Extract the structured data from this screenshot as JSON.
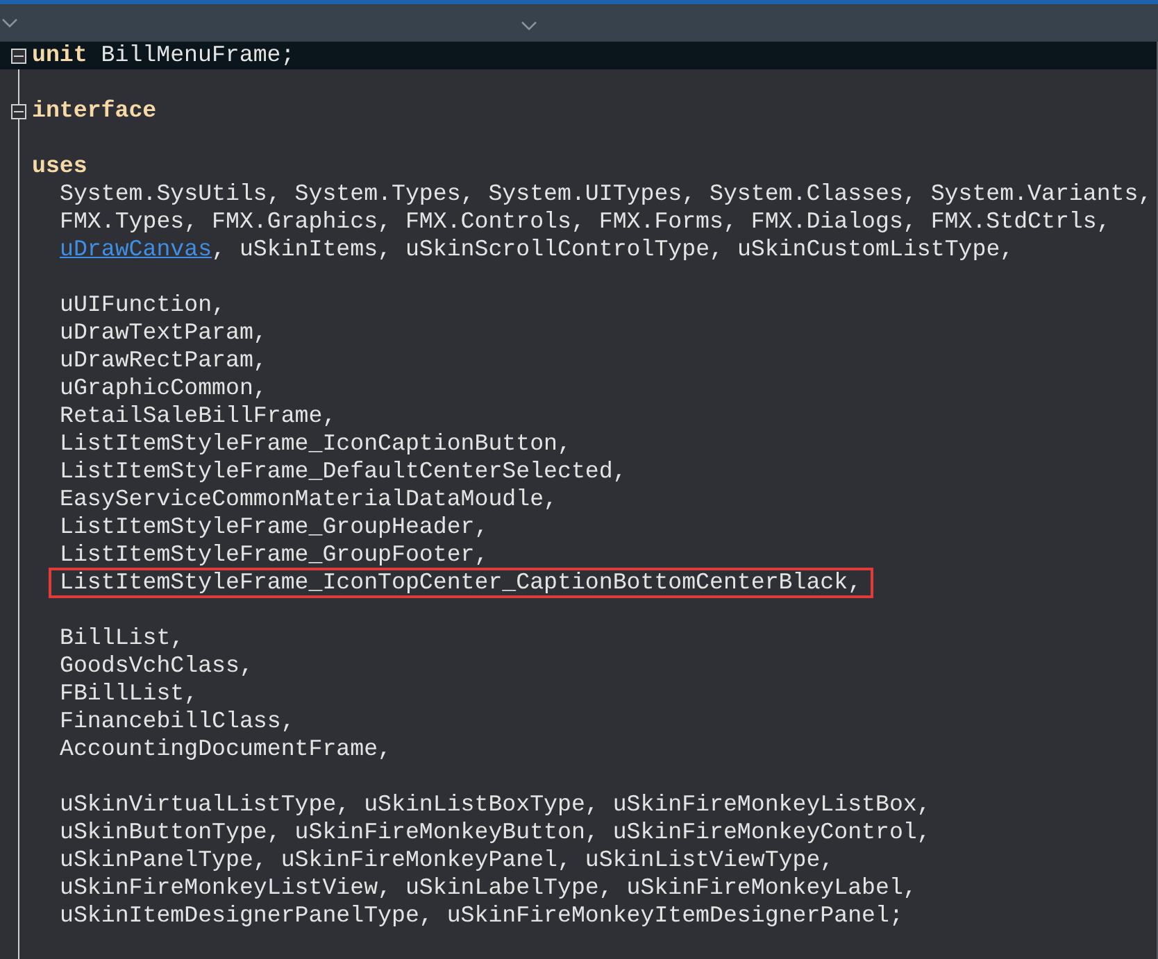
{
  "editor": {
    "lines": [
      {
        "kind": "code",
        "fold": {
          "expanded": true
        },
        "current": true,
        "segments": [
          {
            "kind": "keyword",
            "text": "unit"
          },
          {
            "kind": "plain",
            "text": " BillMenuFrame;"
          }
        ]
      },
      {
        "kind": "blank"
      },
      {
        "kind": "code",
        "fold": {
          "expanded": true
        },
        "segments": [
          {
            "kind": "keyword",
            "text": "interface"
          }
        ]
      },
      {
        "kind": "blank"
      },
      {
        "kind": "code",
        "segments": [
          {
            "kind": "keyword",
            "text": "uses"
          }
        ],
        "children": [
          {
            "kind": "code",
            "segments": [
              {
                "kind": "plain",
                "text": "System.SysUtils, System.Types, System.UITypes, System.Classes, System.Variants,"
              }
            ]
          },
          {
            "kind": "code",
            "segments": [
              {
                "kind": "plain",
                "text": "FMX.Types, FMX.Graphics, FMX.Controls, FMX.Forms, FMX.Dialogs, FMX.StdCtrls,"
              }
            ]
          },
          {
            "kind": "code",
            "segments": [
              {
                "kind": "link",
                "text": "uDrawCanvas"
              },
              {
                "kind": "plain",
                "text": ", uSkinItems, uSkinScrollControlType, uSkinCustomListType,"
              }
            ]
          },
          {
            "kind": "blank"
          },
          {
            "kind": "code",
            "segments": [
              {
                "kind": "plain",
                "text": "uUIFunction,"
              }
            ]
          },
          {
            "kind": "code",
            "segments": [
              {
                "kind": "plain",
                "text": "uDrawTextParam,"
              }
            ]
          },
          {
            "kind": "code",
            "segments": [
              {
                "kind": "plain",
                "text": "uDrawRectParam,"
              }
            ]
          },
          {
            "kind": "code",
            "segments": [
              {
                "kind": "plain",
                "text": "uGraphicCommon,"
              }
            ]
          },
          {
            "kind": "code",
            "segments": [
              {
                "kind": "plain",
                "text": "RetailSaleBillFrame,"
              }
            ]
          },
          {
            "kind": "code",
            "segments": [
              {
                "kind": "plain",
                "text": "ListItemStyleFrame_IconCaptionButton,"
              }
            ]
          },
          {
            "kind": "code",
            "segments": [
              {
                "kind": "plain",
                "text": "ListItemStyleFrame_DefaultCenterSelected,"
              }
            ]
          },
          {
            "kind": "code",
            "segments": [
              {
                "kind": "plain",
                "text": "EasyServiceCommonMaterialDataMoudle,"
              }
            ]
          },
          {
            "kind": "code",
            "segments": [
              {
                "kind": "plain",
                "text": "ListItemStyleFrame_GroupHeader,"
              }
            ]
          },
          {
            "kind": "code",
            "segments": [
              {
                "kind": "plain",
                "text": "ListItemStyleFrame_GroupFooter,"
              }
            ]
          },
          {
            "kind": "code",
            "boxed": true,
            "segments": [
              {
                "kind": "plain",
                "text": "ListItemStyleFrame_IconTopCenter_CaptionBottomCenterBlack,"
              }
            ]
          },
          {
            "kind": "blank"
          },
          {
            "kind": "code",
            "segments": [
              {
                "kind": "plain",
                "text": "BillList,"
              }
            ]
          },
          {
            "kind": "code",
            "segments": [
              {
                "kind": "plain",
                "text": "GoodsVchClass,"
              }
            ]
          },
          {
            "kind": "code",
            "segments": [
              {
                "kind": "plain",
                "text": "FBillList,"
              }
            ]
          },
          {
            "kind": "code",
            "segments": [
              {
                "kind": "plain",
                "text": "FinancebillClass,"
              }
            ]
          },
          {
            "kind": "code",
            "segments": [
              {
                "kind": "plain",
                "text": "AccountingDocumentFrame,"
              }
            ]
          },
          {
            "kind": "blank"
          },
          {
            "kind": "code",
            "segments": [
              {
                "kind": "plain",
                "text": "uSkinVirtualListType, uSkinListBoxType, uSkinFireMonkeyListBox,"
              }
            ]
          },
          {
            "kind": "code",
            "segments": [
              {
                "kind": "plain",
                "text": "uSkinButtonType, uSkinFireMonkeyButton, uSkinFireMonkeyControl,"
              }
            ]
          },
          {
            "kind": "code",
            "segments": [
              {
                "kind": "plain",
                "text": "uSkinPanelType, uSkinFireMonkeyPanel, uSkinListViewType,"
              }
            ]
          },
          {
            "kind": "code",
            "segments": [
              {
                "kind": "plain",
                "text": "uSkinFireMonkeyListView, uSkinLabelType, uSkinFireMonkeyLabel,"
              }
            ]
          },
          {
            "kind": "code",
            "segments": [
              {
                "kind": "plain",
                "text": "uSkinItemDesignerPanelType, uSkinFireMonkeyItemDesignerPanel;"
              }
            ]
          },
          {
            "kind": "blank"
          }
        ]
      }
    ]
  }
}
